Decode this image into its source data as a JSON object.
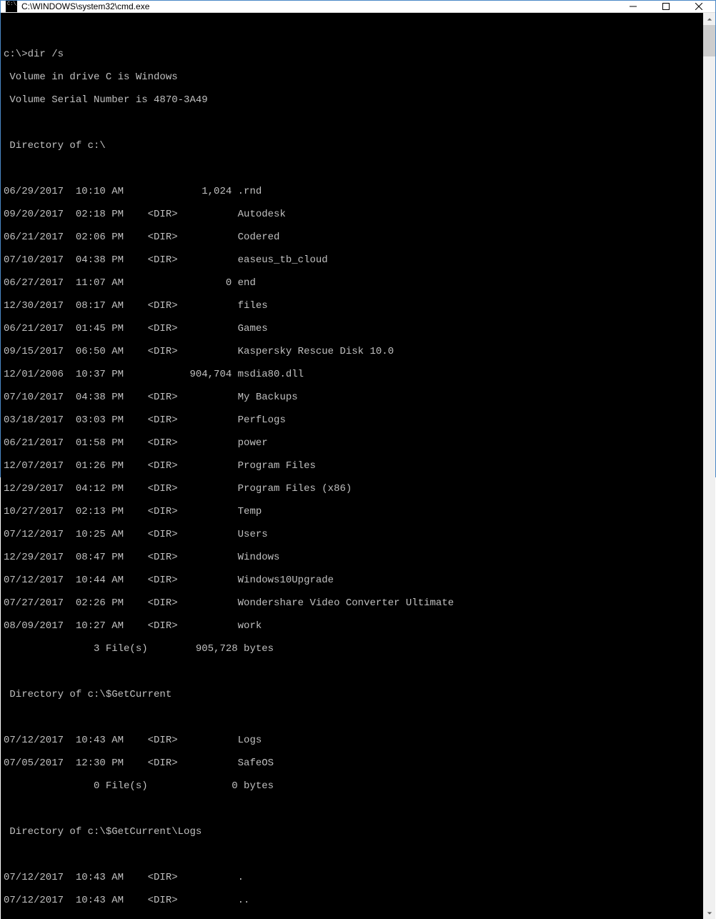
{
  "window": {
    "title": "C:\\WINDOWS\\system32\\cmd.exe"
  },
  "console": {
    "prompt": "c:\\>",
    "command": "dir /s",
    "volume_line": " Volume in drive C is Windows",
    "serial_line": " Volume Serial Number is 4870-3A49",
    "dir_root_header": " Directory of c:\\",
    "root_entries": [
      "06/29/2017  10:10 AM             1,024 .rnd",
      "09/20/2017  02:18 PM    <DIR>          Autodesk",
      "06/21/2017  02:06 PM    <DIR>          Codered",
      "07/10/2017  04:38 PM    <DIR>          easeus_tb_cloud",
      "06/27/2017  11:07 AM                 0 end",
      "12/30/2017  08:17 AM    <DIR>          files",
      "06/21/2017  01:45 PM    <DIR>          Games",
      "09/15/2017  06:50 AM    <DIR>          Kaspersky Rescue Disk 10.0",
      "12/01/2006  10:37 PM           904,704 msdia80.dll",
      "07/10/2017  04:38 PM    <DIR>          My Backups",
      "03/18/2017  03:03 PM    <DIR>          PerfLogs",
      "06/21/2017  01:58 PM    <DIR>          power",
      "12/07/2017  01:26 PM    <DIR>          Program Files",
      "12/29/2017  04:12 PM    <DIR>          Program Files (x86)",
      "10/27/2017  02:13 PM    <DIR>          Temp",
      "07/12/2017  10:25 AM    <DIR>          Users",
      "12/29/2017  08:47 PM    <DIR>          Windows",
      "07/12/2017  10:44 AM    <DIR>          Windows10Upgrade",
      "07/27/2017  02:26 PM    <DIR>          Wondershare Video Converter Ultimate",
      "08/09/2017  10:27 AM    <DIR>          work"
    ],
    "root_summary": "               3 File(s)        905,728 bytes",
    "dir_getcurrent_header": " Directory of c:\\$GetCurrent",
    "getcurrent_entries": [
      "07/12/2017  10:43 AM    <DIR>          Logs",
      "07/05/2017  12:30 PM    <DIR>          SafeOS"
    ],
    "getcurrent_summary": "               0 File(s)              0 bytes",
    "dir_logs_header": " Directory of c:\\$GetCurrent\\Logs",
    "logs_entries": [
      "07/12/2017  10:43 AM    <DIR>          .",
      "07/12/2017  10:43 AM    <DIR>          .."
    ]
  }
}
